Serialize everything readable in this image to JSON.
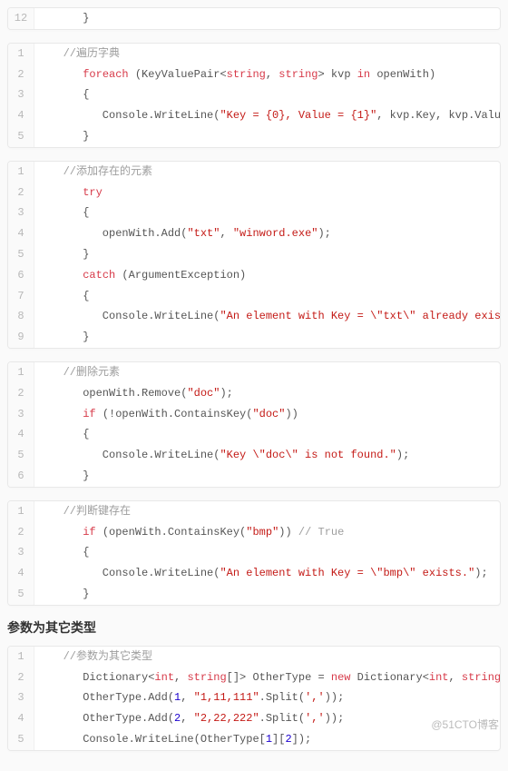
{
  "blocks": [
    {
      "id": "block0",
      "lines": [
        {
          "num": "12",
          "tokens": [
            {
              "t": "      }",
              "c": ""
            }
          ]
        }
      ]
    },
    {
      "id": "block1",
      "lines": [
        {
          "num": "1",
          "tokens": [
            {
              "t": "   ",
              "c": ""
            },
            {
              "t": "//遍历字典",
              "c": "cm"
            }
          ]
        },
        {
          "num": "2",
          "tokens": [
            {
              "t": "      ",
              "c": ""
            },
            {
              "t": "foreach",
              "c": "kw"
            },
            {
              "t": " (KeyValuePair<",
              "c": ""
            },
            {
              "t": "string",
              "c": "ty"
            },
            {
              "t": ", ",
              "c": ""
            },
            {
              "t": "string",
              "c": "ty"
            },
            {
              "t": "> kvp ",
              "c": ""
            },
            {
              "t": "in",
              "c": "kw"
            },
            {
              "t": " openWith)",
              "c": ""
            }
          ]
        },
        {
          "num": "3",
          "tokens": [
            {
              "t": "      {",
              "c": ""
            }
          ]
        },
        {
          "num": "4",
          "tokens": [
            {
              "t": "         Console.WriteLine(",
              "c": ""
            },
            {
              "t": "\"Key = {0}, Value = {1}\"",
              "c": "st"
            },
            {
              "t": ", kvp.Key, kvp.Value);",
              "c": ""
            }
          ]
        },
        {
          "num": "5",
          "tokens": [
            {
              "t": "      }",
              "c": ""
            }
          ]
        }
      ]
    },
    {
      "id": "block2",
      "lines": [
        {
          "num": "1",
          "tokens": [
            {
              "t": "   ",
              "c": ""
            },
            {
              "t": "//添加存在的元素",
              "c": "cm"
            }
          ]
        },
        {
          "num": "2",
          "tokens": [
            {
              "t": "      ",
              "c": ""
            },
            {
              "t": "try",
              "c": "kw"
            }
          ]
        },
        {
          "num": "3",
          "tokens": [
            {
              "t": "      {",
              "c": ""
            }
          ]
        },
        {
          "num": "4",
          "tokens": [
            {
              "t": "         openWith.Add(",
              "c": ""
            },
            {
              "t": "\"txt\"",
              "c": "st"
            },
            {
              "t": ", ",
              "c": ""
            },
            {
              "t": "\"winword.exe\"",
              "c": "st"
            },
            {
              "t": ");",
              "c": ""
            }
          ]
        },
        {
          "num": "5",
          "tokens": [
            {
              "t": "      }",
              "c": ""
            }
          ]
        },
        {
          "num": "6",
          "tokens": [
            {
              "t": "      ",
              "c": ""
            },
            {
              "t": "catch",
              "c": "kw"
            },
            {
              "t": " (ArgumentException)",
              "c": ""
            }
          ]
        },
        {
          "num": "7",
          "tokens": [
            {
              "t": "      {",
              "c": ""
            }
          ]
        },
        {
          "num": "8",
          "tokens": [
            {
              "t": "         Console.WriteLine(",
              "c": ""
            },
            {
              "t": "\"An element with Key = \\\"txt\\\" already exists.\"",
              "c": "st"
            },
            {
              "t": ");",
              "c": ""
            }
          ]
        },
        {
          "num": "9",
          "tokens": [
            {
              "t": "      }",
              "c": ""
            }
          ]
        }
      ]
    },
    {
      "id": "block3",
      "lines": [
        {
          "num": "1",
          "tokens": [
            {
              "t": "   ",
              "c": ""
            },
            {
              "t": "//删除元素",
              "c": "cm"
            }
          ]
        },
        {
          "num": "2",
          "tokens": [
            {
              "t": "      openWith.Remove(",
              "c": ""
            },
            {
              "t": "\"doc\"",
              "c": "st"
            },
            {
              "t": ");",
              "c": ""
            }
          ]
        },
        {
          "num": "3",
          "tokens": [
            {
              "t": "      ",
              "c": ""
            },
            {
              "t": "if",
              "c": "kw"
            },
            {
              "t": " (!openWith.ContainsKey(",
              "c": ""
            },
            {
              "t": "\"doc\"",
              "c": "st"
            },
            {
              "t": "))",
              "c": ""
            }
          ]
        },
        {
          "num": "4",
          "tokens": [
            {
              "t": "      {",
              "c": ""
            }
          ]
        },
        {
          "num": "5",
          "tokens": [
            {
              "t": "         Console.WriteLine(",
              "c": ""
            },
            {
              "t": "\"Key \\\"doc\\\" is not found.\"",
              "c": "st"
            },
            {
              "t": ");",
              "c": ""
            }
          ]
        },
        {
          "num": "6",
          "tokens": [
            {
              "t": "      }",
              "c": ""
            }
          ]
        }
      ]
    },
    {
      "id": "block4",
      "lines": [
        {
          "num": "1",
          "tokens": [
            {
              "t": "   ",
              "c": ""
            },
            {
              "t": "//判断键存在",
              "c": "cm"
            }
          ]
        },
        {
          "num": "2",
          "tokens": [
            {
              "t": "      ",
              "c": ""
            },
            {
              "t": "if",
              "c": "kw"
            },
            {
              "t": " (openWith.ContainsKey(",
              "c": ""
            },
            {
              "t": "\"bmp\"",
              "c": "st"
            },
            {
              "t": ")) ",
              "c": ""
            },
            {
              "t": "// True",
              "c": "cm"
            }
          ]
        },
        {
          "num": "3",
          "tokens": [
            {
              "t": "      {",
              "c": ""
            }
          ]
        },
        {
          "num": "4",
          "tokens": [
            {
              "t": "         Console.WriteLine(",
              "c": ""
            },
            {
              "t": "\"An element with Key = \\\"bmp\\\" exists.\"",
              "c": "st"
            },
            {
              "t": ");",
              "c": ""
            }
          ]
        },
        {
          "num": "5",
          "tokens": [
            {
              "t": "      }",
              "c": ""
            }
          ]
        }
      ]
    },
    {
      "id": "block5",
      "lines": [
        {
          "num": "1",
          "tokens": [
            {
              "t": "   ",
              "c": ""
            },
            {
              "t": "//参数为其它类型",
              "c": "cm"
            }
          ]
        },
        {
          "num": "2",
          "tokens": [
            {
              "t": "      Dictionary<",
              "c": ""
            },
            {
              "t": "int",
              "c": "ty"
            },
            {
              "t": ", ",
              "c": ""
            },
            {
              "t": "string",
              "c": "ty"
            },
            {
              "t": "[]> OtherType = ",
              "c": ""
            },
            {
              "t": "new",
              "c": "kw"
            },
            {
              "t": " Dictionary<",
              "c": ""
            },
            {
              "t": "int",
              "c": "ty"
            },
            {
              "t": ", ",
              "c": ""
            },
            {
              "t": "string",
              "c": "ty"
            },
            {
              "t": "[]>();",
              "c": ""
            }
          ]
        },
        {
          "num": "3",
          "tokens": [
            {
              "t": "      OtherType.Add(",
              "c": ""
            },
            {
              "t": "1",
              "c": "nu"
            },
            {
              "t": ", ",
              "c": ""
            },
            {
              "t": "\"1,11,111\"",
              "c": "st"
            },
            {
              "t": ".Split(",
              "c": ""
            },
            {
              "t": "','",
              "c": "st"
            },
            {
              "t": "));",
              "c": ""
            }
          ]
        },
        {
          "num": "4",
          "tokens": [
            {
              "t": "      OtherType.Add(",
              "c": ""
            },
            {
              "t": "2",
              "c": "nu"
            },
            {
              "t": ", ",
              "c": ""
            },
            {
              "t": "\"2,22,222\"",
              "c": "st"
            },
            {
              "t": ".Split(",
              "c": ""
            },
            {
              "t": "','",
              "c": "st"
            },
            {
              "t": "));",
              "c": ""
            }
          ]
        },
        {
          "num": "5",
          "tokens": [
            {
              "t": "      Console.WriteLine(OtherType[",
              "c": ""
            },
            {
              "t": "1",
              "c": "nu"
            },
            {
              "t": "][",
              "c": ""
            },
            {
              "t": "2",
              "c": "nu"
            },
            {
              "t": "]);",
              "c": ""
            }
          ]
        }
      ]
    }
  ],
  "heading": "参数为其它类型",
  "watermark": "@51CTO博客"
}
